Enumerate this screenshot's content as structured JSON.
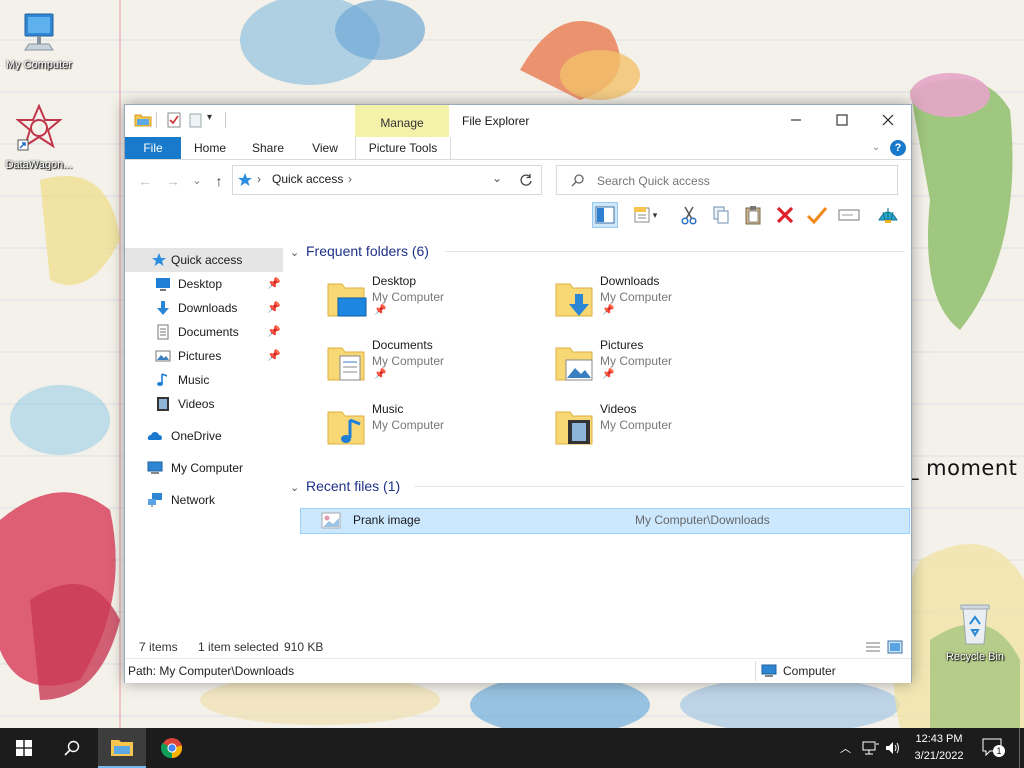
{
  "desktop": {
    "icons": [
      {
        "label": "My Computer"
      },
      {
        "label": "DataWagon..."
      },
      {
        "label": "Recycle Bin"
      }
    ],
    "wallpaper_text": "_ moment"
  },
  "window": {
    "title": "File Explorer",
    "contextual_tab_group": "Manage",
    "ribbon_tabs": {
      "file": "File",
      "home": "Home",
      "share": "Share",
      "view": "View",
      "picture_tools": "Picture Tools"
    },
    "address": {
      "path": "Quick access"
    },
    "search": {
      "placeholder": "Search Quick access"
    }
  },
  "navpane": {
    "quick_access": "Quick access",
    "items": [
      {
        "label": "Desktop",
        "icon": "desktop-icon",
        "pinned": true
      },
      {
        "label": "Downloads",
        "icon": "downloads-icon",
        "pinned": true
      },
      {
        "label": "Documents",
        "icon": "documents-icon",
        "pinned": true
      },
      {
        "label": "Pictures",
        "icon": "pictures-icon",
        "pinned": true
      },
      {
        "label": "Music",
        "icon": "music-icon",
        "pinned": false
      },
      {
        "label": "Videos",
        "icon": "videos-icon",
        "pinned": false
      }
    ],
    "onedrive": "OneDrive",
    "my_computer": "My Computer",
    "network": "Network"
  },
  "content": {
    "frequent_header": "Frequent folders (6)",
    "frequent": [
      {
        "name": "Desktop",
        "location": "My Computer",
        "pinned": true
      },
      {
        "name": "Downloads",
        "location": "My Computer",
        "pinned": true
      },
      {
        "name": "Documents",
        "location": "My Computer",
        "pinned": true
      },
      {
        "name": "Pictures",
        "location": "My Computer",
        "pinned": true
      },
      {
        "name": "Music",
        "location": "My Computer",
        "pinned": false
      },
      {
        "name": "Videos",
        "location": "My Computer",
        "pinned": false
      }
    ],
    "recent_header": "Recent files (1)",
    "recent": [
      {
        "name": "Prank image",
        "path": "My Computer\\Downloads"
      }
    ]
  },
  "status": {
    "items": "7 items",
    "selected": "1 item selected",
    "size": "910 KB",
    "path": "Path: My Computer\\Downloads",
    "location": "Computer"
  },
  "taskbar": {
    "time": "12:43 PM",
    "date": "3/21/2022",
    "notification_count": "1"
  },
  "colors": {
    "accent": "#1979ca",
    "selection": "#cce8ff",
    "manage_tab": "#f4f1a8",
    "folder": "#f8d775",
    "taskbar": "#1c1c1c"
  }
}
